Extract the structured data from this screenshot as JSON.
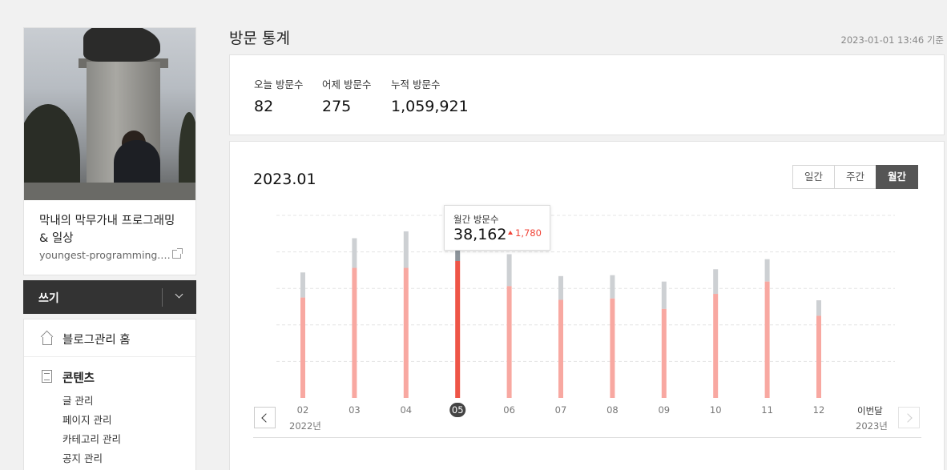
{
  "sidebar": {
    "blog_name": "막내의 막무가내 프로그래밍 & 일상",
    "blog_url": "youngest-programming.tistory.com",
    "write_label": "쓰기",
    "home_label": "블로그관리 홈",
    "content_label": "콘텐츠",
    "content_items": [
      "글 관리",
      "페이지 관리",
      "카테고리 관리",
      "공지 관리"
    ]
  },
  "header": {
    "title": "방문 통계",
    "base_time": "2023-01-01 13:46 기준"
  },
  "summary": {
    "today_label": "오늘 방문수",
    "today_value": "82",
    "yesterday_label": "어제 방문수",
    "yesterday_value": "275",
    "total_label": "누적 방문수",
    "total_value": "1,059,921"
  },
  "chart": {
    "period": "2023.01",
    "tabs": [
      "일간",
      "주간",
      "월간"
    ],
    "active_tab": "월간",
    "tooltip_label": "월간 방문수",
    "tooltip_value": "38,162",
    "tooltip_diff": "1,780",
    "year_start": "2022년",
    "year_end": "2023년",
    "last_label": "이번달"
  },
  "colors": {
    "bar": "#f8a8a1",
    "bar_selected": "#ee5547",
    "bar_top": "#cdd0d3",
    "bar_top_selected": "#8d949b",
    "accent": "#f04438"
  },
  "chart_data": {
    "type": "bar",
    "categories": [
      "02",
      "03",
      "04",
      "05",
      "06",
      "07",
      "08",
      "09",
      "10",
      "11",
      "12"
    ],
    "selected": "05",
    "ylim": [
      0,
      40000
    ],
    "grid": true,
    "series": [
      {
        "values": [
          22000,
          28500,
          28500,
          30000,
          24500,
          21500,
          21800,
          19500,
          22800,
          25500,
          18000
        ]
      },
      {
        "values": [
          27500,
          35000,
          36500,
          38162,
          31500,
          26700,
          26900,
          25500,
          28200,
          30400,
          21400
        ]
      }
    ]
  }
}
